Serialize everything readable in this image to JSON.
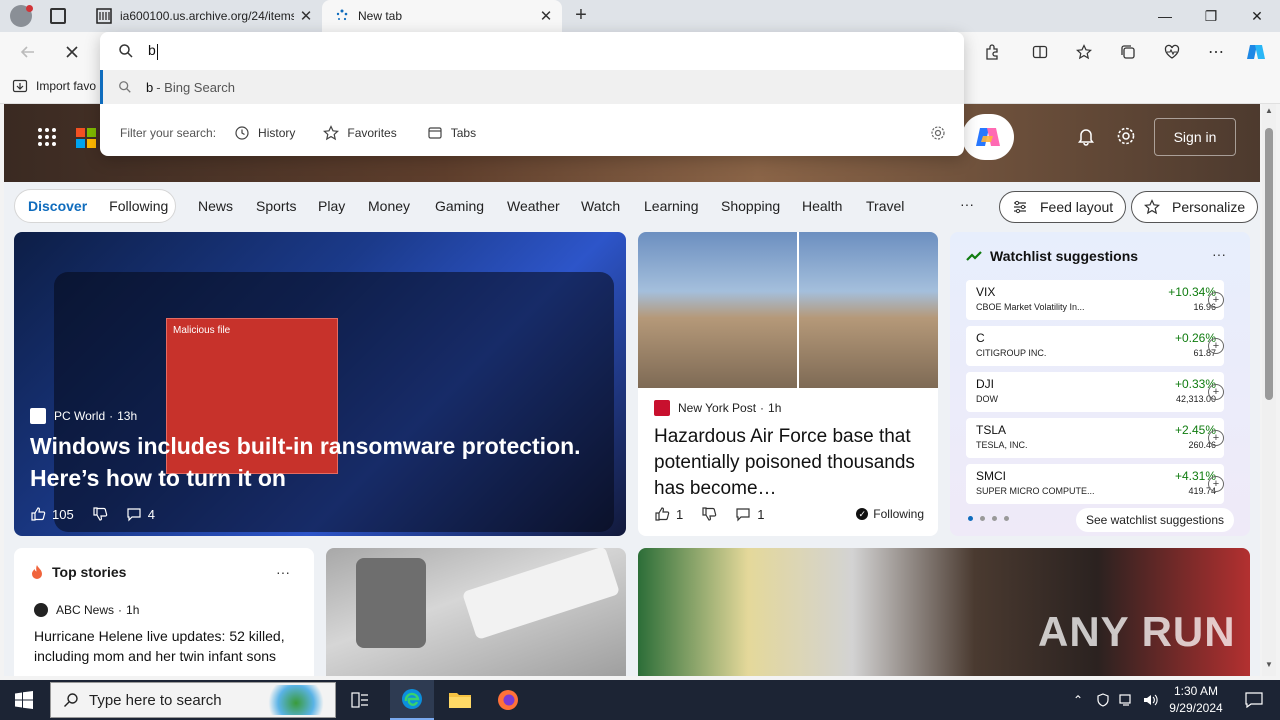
{
  "tabs": [
    {
      "title": "ia600100.us.archive.org/24/items/..."
    },
    {
      "title": "New tab"
    }
  ],
  "omnibox": {
    "value": "b",
    "suggestion_primary": "b",
    "suggestion_secondary": "- Bing Search",
    "filter_label": "Filter your search:",
    "filters": [
      "History",
      "Favorites",
      "Tabs"
    ]
  },
  "favorites_bar": {
    "import_label": "Import favo"
  },
  "header": {
    "sign_in": "Sign in"
  },
  "nav": {
    "discover": "Discover",
    "following": "Following",
    "items": [
      "News",
      "Sports",
      "Play",
      "Money",
      "Gaming",
      "Weather",
      "Watch",
      "Learning",
      "Shopping",
      "Health",
      "Travel"
    ],
    "more": "···",
    "feed_layout": "Feed layout",
    "personalize": "Personalize"
  },
  "hero": {
    "source": "PC World",
    "time": "13h",
    "headline": "Windows includes built-in ransomware protection. Here’s how to turn it on",
    "likes": "105",
    "comments": "4",
    "popup_title": "Malicious file"
  },
  "nyp": {
    "source": "New York Post",
    "time": "1h",
    "headline": "Hazardous Air Force base that potentially poisoned thousands has become…",
    "likes": "1",
    "comments": "1",
    "following": "Following"
  },
  "watchlist": {
    "title": "Watchlist suggestions",
    "stocks": [
      {
        "sym": "VIX",
        "name": "CBOE Market Volatility In...",
        "change": "+10.34%",
        "price": "16.96"
      },
      {
        "sym": "C",
        "name": "CITIGROUP INC.",
        "change": "+0.26%",
        "price": "61.87"
      },
      {
        "sym": "DJI",
        "name": "DOW",
        "change": "+0.33%",
        "price": "42,313.00"
      },
      {
        "sym": "TSLA",
        "name": "TESLA, INC.",
        "change": "+2.45%",
        "price": "260.46"
      },
      {
        "sym": "SMCI",
        "name": "SUPER MICRO COMPUTE...",
        "change": "+4.31%",
        "price": "419.74"
      }
    ],
    "see_all": "See watchlist suggestions"
  },
  "top_stories": {
    "title": "Top stories",
    "source": "ABC News",
    "time": "1h",
    "headline": "Hurricane Helene live updates: 52 killed, including mom and her twin infant sons"
  },
  "watermark": "ANY RUN",
  "taskbar": {
    "search_placeholder": "Type here to search",
    "time": "1:30 AM",
    "date": "9/29/2024"
  },
  "colors": {
    "accent": "#0f6cbd",
    "positive": "#107c10",
    "taskbar": "#1c2434"
  }
}
